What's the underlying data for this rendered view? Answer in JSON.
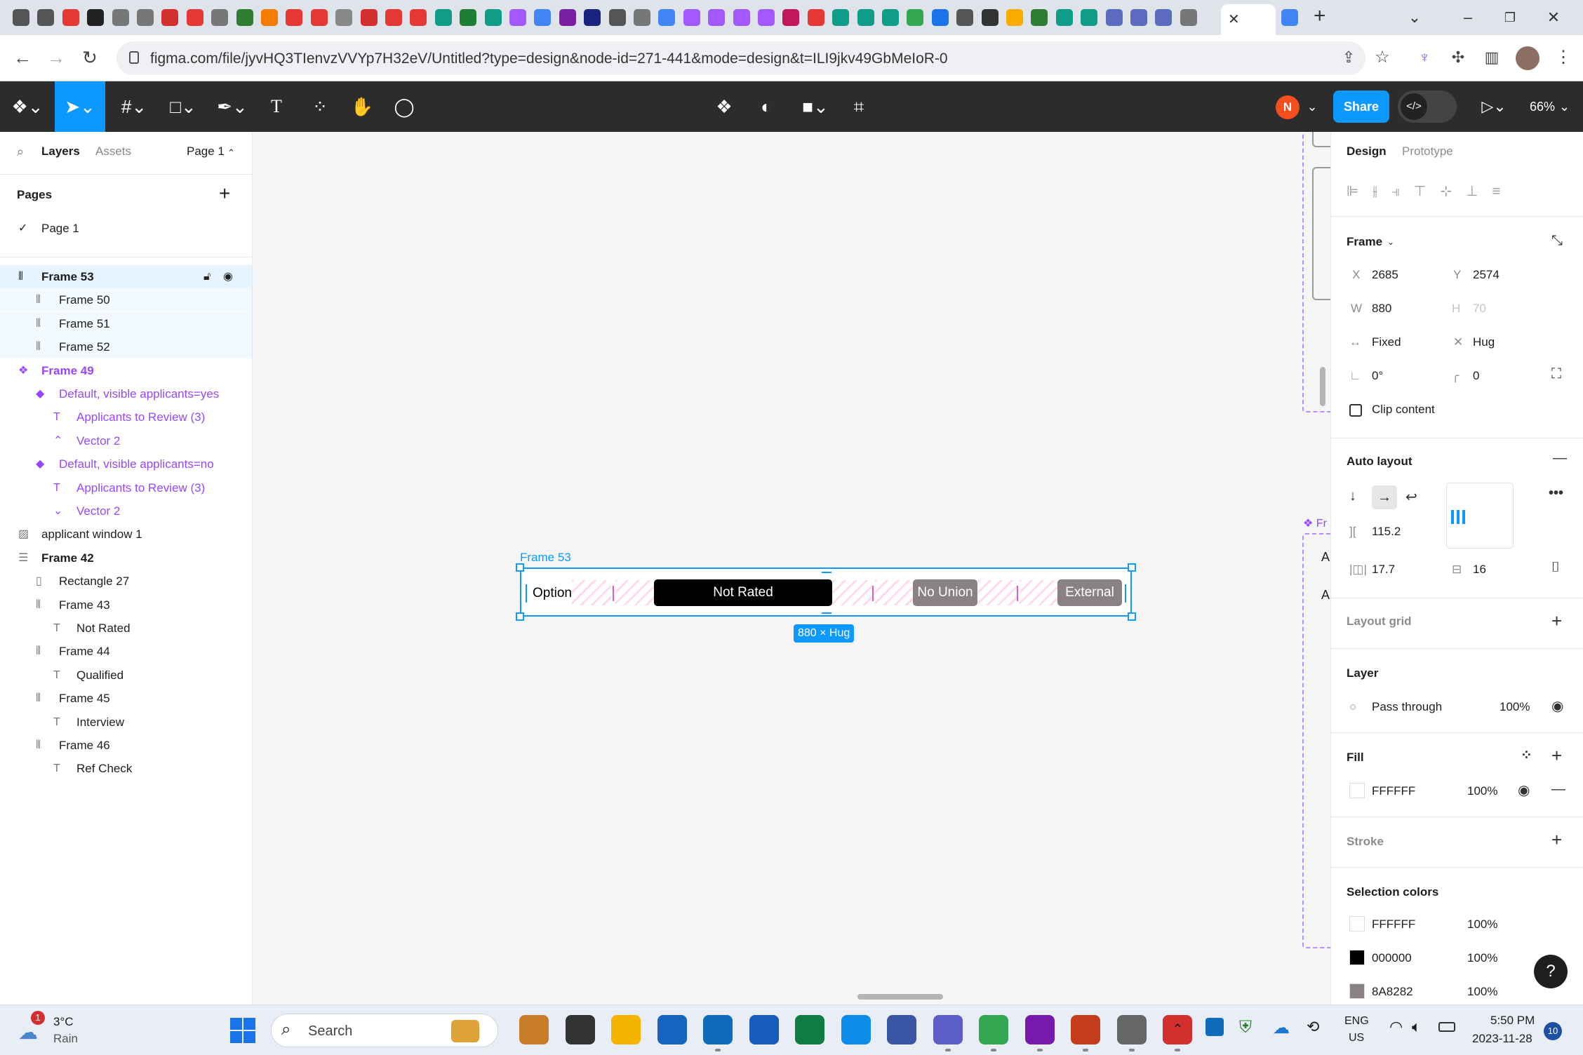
{
  "browser": {
    "url": "figma.com/file/jyvHQ3TIenvzVVYp7H32eV/Untitled?type=design&node-id=271-441&mode=design&t=ILI9jkv49GbMeIoR-0",
    "active_tab_close": "✕",
    "new_tab": "+"
  },
  "toolbar": {
    "avatar_initial": "N",
    "share_label": "Share",
    "zoom": "66%"
  },
  "left_panel": {
    "tabs": [
      "Layers",
      "Assets"
    ],
    "page_selector": "Page 1",
    "pages_title": "Pages",
    "pages": [
      {
        "label": "Page 1",
        "current": true
      }
    ],
    "layers": [
      {
        "label": "Frame 53",
        "indent": 0,
        "type": "frame-auto",
        "state": "selected"
      },
      {
        "label": "Frame 50",
        "indent": 1,
        "type": "frame-auto",
        "state": "child"
      },
      {
        "label": "Frame 51",
        "indent": 1,
        "type": "frame-auto",
        "state": "child"
      },
      {
        "label": "Frame 52",
        "indent": 1,
        "type": "frame-auto",
        "state": "child"
      },
      {
        "label": "Frame 49",
        "indent": 0,
        "type": "component-set",
        "state": "component"
      },
      {
        "label": "Default, visible applicants=yes",
        "indent": 1,
        "type": "variant",
        "state": "component"
      },
      {
        "label": "Applicants to Review (3)",
        "indent": 2,
        "type": "text",
        "state": "component"
      },
      {
        "label": "Vector 2",
        "indent": 2,
        "type": "vector-up",
        "state": "component"
      },
      {
        "label": "Default, visible applicants=no",
        "indent": 1,
        "type": "variant",
        "state": "component"
      },
      {
        "label": "Applicants to Review (3)",
        "indent": 2,
        "type": "text",
        "state": "component"
      },
      {
        "label": "Vector 2",
        "indent": 2,
        "type": "vector-down",
        "state": "component"
      },
      {
        "label": "applicant window 1",
        "indent": 0,
        "type": "image",
        "state": "normal"
      },
      {
        "label": "Frame 42",
        "indent": 0,
        "type": "frame-list",
        "state": "normal"
      },
      {
        "label": "Rectangle 27",
        "indent": 1,
        "type": "rect",
        "state": "normal"
      },
      {
        "label": "Frame 43",
        "indent": 1,
        "type": "frame-auto",
        "state": "normal"
      },
      {
        "label": "Not Rated",
        "indent": 2,
        "type": "text",
        "state": "normal"
      },
      {
        "label": "Frame 44",
        "indent": 1,
        "type": "frame-auto",
        "state": "normal"
      },
      {
        "label": "Qualified",
        "indent": 2,
        "type": "text",
        "state": "normal"
      },
      {
        "label": "Frame 45",
        "indent": 1,
        "type": "frame-auto",
        "state": "normal"
      },
      {
        "label": "Interview",
        "indent": 2,
        "type": "text",
        "state": "normal"
      },
      {
        "label": "Frame 46",
        "indent": 1,
        "type": "frame-auto",
        "state": "normal"
      },
      {
        "label": "Ref Check",
        "indent": 2,
        "type": "text",
        "state": "normal"
      }
    ]
  },
  "canvas": {
    "frame_label": "Frame 53",
    "option_label": "Option",
    "pills": [
      {
        "label": "Not Rated",
        "color": "#000000"
      },
      {
        "label": "No Union",
        "color": "#8A8282"
      },
      {
        "label": "External",
        "color": "#8A8282"
      }
    ],
    "dimension_badge": "880 × Hug",
    "side_frame_label": "Fr",
    "side_frame_letters": [
      "A",
      "A"
    ]
  },
  "right_panel": {
    "tabs": [
      "Design",
      "Prototype"
    ],
    "frame_title": "Frame",
    "x_label": "X",
    "x": "2685",
    "y_label": "Y",
    "y": "2574",
    "w_label": "W",
    "w": "880",
    "h_label": "H",
    "h": "70",
    "width_mode": "Fixed",
    "height_mode": "Hug",
    "rotation": "0°",
    "radius": "0",
    "clip_content": "Clip content",
    "auto_layout_title": "Auto layout",
    "gap": "115.2",
    "padding_h": "17.7",
    "padding_v": "16",
    "layout_grid_title": "Layout grid",
    "layer_title": "Layer",
    "blend_mode": "Pass through",
    "layer_opacity": "100%",
    "fill_title": "Fill",
    "fill_hex": "FFFFFF",
    "fill_opacity": "100%",
    "stroke_title": "Stroke",
    "selection_colors_title": "Selection colors",
    "selection_colors": [
      {
        "hex": "FFFFFF",
        "opacity": "100%",
        "color": "#FFFFFF"
      },
      {
        "hex": "000000",
        "opacity": "100%",
        "color": "#000000"
      },
      {
        "hex": "8A8282",
        "opacity": "100%",
        "color": "#8A8282"
      }
    ],
    "help": "?"
  },
  "taskbar": {
    "weather_temp": "3°C",
    "weather_desc": "Rain",
    "weather_badge": "1",
    "search_label": "Search",
    "lang_1": "ENG",
    "lang_2": "US",
    "time": "5:50 PM",
    "date": "2023-11-28",
    "notif_count": "10"
  },
  "colors": {
    "figma_blue": "#0d99ff",
    "component_purple": "#9747ff",
    "toolbar_dark": "#2c2c2c"
  }
}
